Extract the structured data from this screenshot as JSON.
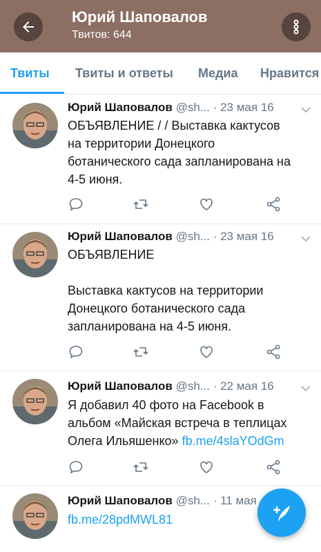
{
  "header": {
    "title": "Юрий Шаповалов",
    "subtitle": "Твитов: 644",
    "back_icon": "arrow-left-icon",
    "more_icon": "more-vertical-icon",
    "background": "#8c6e63"
  },
  "tabs": [
    {
      "label": "Твиты",
      "active": true
    },
    {
      "label": "Твиты и ответы",
      "active": false
    },
    {
      "label": "Медиа",
      "active": false
    },
    {
      "label": "Нравится",
      "active": false
    }
  ],
  "tweets": [
    {
      "name": "Юрий Шаповалов",
      "handle": "@sh...",
      "date": "· 23 мая 16",
      "lines": [
        "ОБЪЯВЛЕНИЕ /  / Выставка кактусов",
        "на территории Донецкого",
        "ботанического сада запланирована на",
        "4-5 июня."
      ]
    },
    {
      "name": "Юрий Шаповалов",
      "handle": "@sh...",
      "date": "· 23 мая 16",
      "lines": [
        "ОБЪЯВЛЕНИЕ",
        "",
        "Выставка кактусов на территории",
        "Донецкого ботанического сада",
        "запланирована на 4-5 июня."
      ]
    },
    {
      "name": "Юрий Шаповалов",
      "handle": "@sh...",
      "date": "· 22 мая 16",
      "lines": [
        "Я добавил 40 фото на Facebook в",
        "альбом «Майская встреча в теплицах",
        "Олега Ильяшенко»"
      ],
      "link": "fb.me/4slaYOdGm"
    },
    {
      "name": "Юрий Шаповалов",
      "handle": "@sh...",
      "date": "· 11 мая",
      "link": "fb.me/28pdMWL81"
    }
  ],
  "accent_color": "#1da1f2",
  "compose_icon": "compose-tweet-icon"
}
